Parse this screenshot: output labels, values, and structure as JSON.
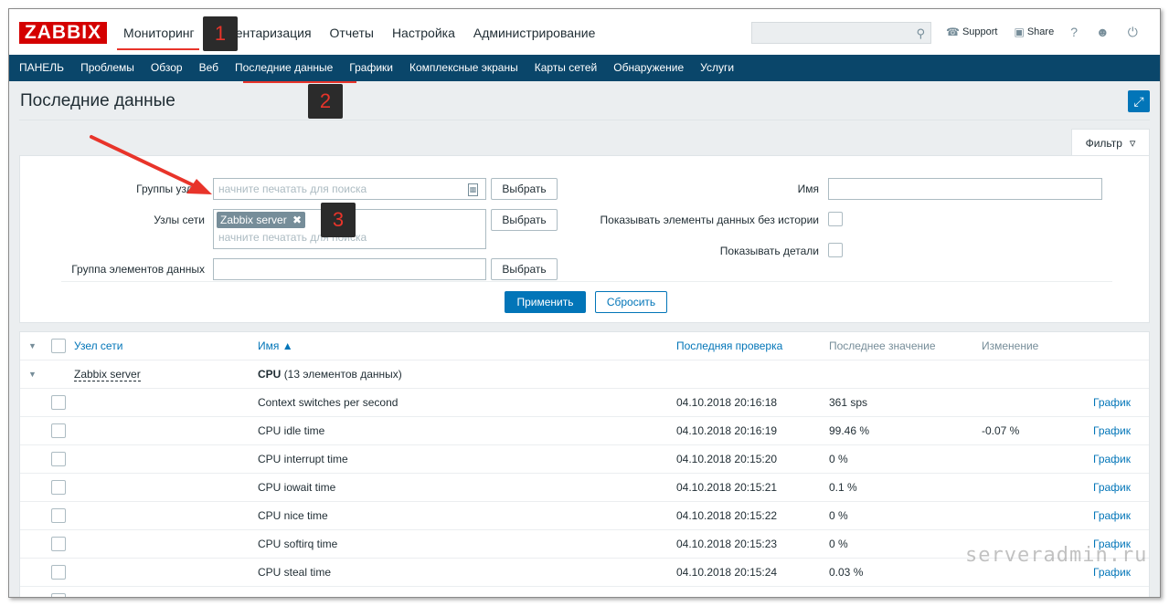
{
  "header": {
    "logo": "ZABBIX",
    "nav": [
      "Мониторинг",
      "Инвентаризация",
      "Отчеты",
      "Настройка",
      "Администрирование"
    ],
    "search_placeholder": "",
    "support": "Support",
    "share": "Share",
    "help": "?",
    "user": "user-icon",
    "power": "power-icon"
  },
  "subnav": [
    "ПАНЕЛЬ",
    "Проблемы",
    "Обзор",
    "Веб",
    "Последние данные",
    "Графики",
    "Комплексные экраны",
    "Карты сетей",
    "Обнаружение",
    "Услуги"
  ],
  "page": {
    "title": "Последние данные"
  },
  "filter": {
    "tab_label": "Фильтр",
    "host_groups_label": "Группы узлов",
    "host_groups_placeholder": "начните печатать для поиска",
    "hosts_label": "Узлы сети",
    "hosts_tag": "Zabbix server",
    "hosts_placeholder": "начните печатать для поиска",
    "app_label": "Группа элементов данных",
    "select_label": "Выбрать",
    "name_label": "Имя",
    "show_without_history_label": "Показывать элементы данных без истории",
    "show_details_label": "Показывать детали",
    "apply_label": "Применить",
    "reset_label": "Сбросить"
  },
  "table": {
    "headers": {
      "host": "Узел сети",
      "name": "Имя ▲",
      "last_check": "Последняя проверка",
      "last_value": "Последнее значение",
      "change": "Изменение"
    },
    "group": {
      "host": "Zabbix server",
      "app": "CPU",
      "count": "(13 элементов данных)"
    },
    "rows": [
      {
        "name": "Context switches per second",
        "last_check": "04.10.2018 20:16:18",
        "last_value": "361 sps",
        "change": "",
        "action": "График"
      },
      {
        "name": "CPU idle time",
        "last_check": "04.10.2018 20:16:19",
        "last_value": "99.46 %",
        "change": "-0.07 %",
        "action": "График"
      },
      {
        "name": "CPU interrupt time",
        "last_check": "04.10.2018 20:15:20",
        "last_value": "0 %",
        "change": "",
        "action": "График"
      },
      {
        "name": "CPU iowait time",
        "last_check": "04.10.2018 20:15:21",
        "last_value": "0.1 %",
        "change": "",
        "action": "График"
      },
      {
        "name": "CPU nice time",
        "last_check": "04.10.2018 20:15:22",
        "last_value": "0 %",
        "change": "",
        "action": "График"
      },
      {
        "name": "CPU softirq time",
        "last_check": "04.10.2018 20:15:23",
        "last_value": "0 %",
        "change": "",
        "action": "График"
      },
      {
        "name": "CPU steal time",
        "last_check": "04.10.2018 20:15:24",
        "last_value": "0.03 %",
        "change": "",
        "action": "График"
      }
    ]
  },
  "annotations": [
    "1",
    "2",
    "3"
  ],
  "watermark": "serveradmin.ru",
  "colors": {
    "brand": "#d40000",
    "nav_bg": "#0a466a",
    "accent": "#0275b8",
    "annotation": "#e8342a"
  }
}
